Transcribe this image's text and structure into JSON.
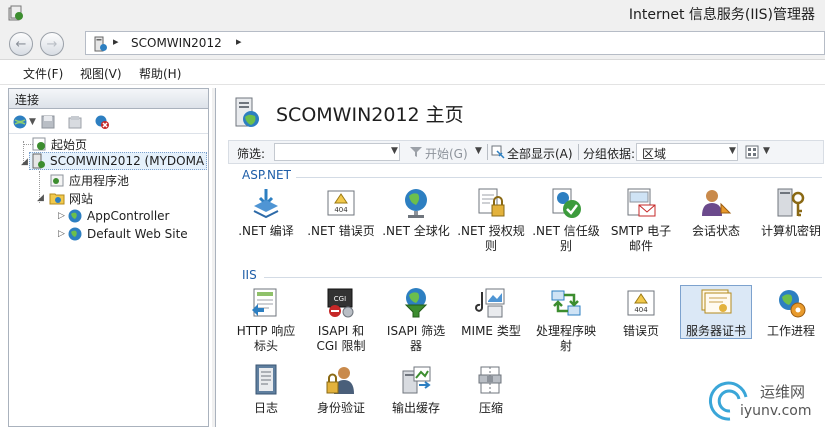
{
  "window": {
    "title": "Internet 信息服务(IIS)管理器"
  },
  "address": {
    "crumb": "SCOMWIN2012",
    "sep": "▸"
  },
  "menus": [
    "文件(F)",
    "视图(V)",
    "帮助(H)"
  ],
  "connections": {
    "header": "连接",
    "tree": [
      "起始页",
      "SCOMWIN2012 (MYDOMA",
      "应用程序池",
      "网站",
      "AppController",
      "Default Web Site"
    ]
  },
  "main": {
    "title": "SCOMWIN2012 主页",
    "filter": {
      "label": "筛选:",
      "start_label": "开始(G)",
      "showall_label": "全部显示(A)",
      "group_label": "分组依据:",
      "group_value": "区域"
    },
    "sections": [
      {
        "title": "ASP.NET",
        "items": [
          ".NET 编译",
          ".NET 错误页",
          ".NET 全球化",
          ".NET 授权规则",
          ".NET 信任级别",
          "SMTP 电子邮件",
          "会话状态",
          "计算机密钥"
        ]
      },
      {
        "title": "IIS",
        "items": [
          "HTTP 响应标头",
          "ISAPI 和 CGI 限制",
          "ISAPI 筛选器",
          "MIME 类型",
          "处理程序映射",
          "错误页",
          "服务器证书",
          "工作进程",
          "日志",
          "身份验证",
          "输出缓存",
          "压缩"
        ]
      }
    ],
    "selected_feature": "服务器证书"
  },
  "watermark": {
    "line1": "运维网",
    "line2": "iyunv.com"
  },
  "colors": {
    "accent": "#1e5ea8",
    "selection": "#dbe8f6"
  }
}
